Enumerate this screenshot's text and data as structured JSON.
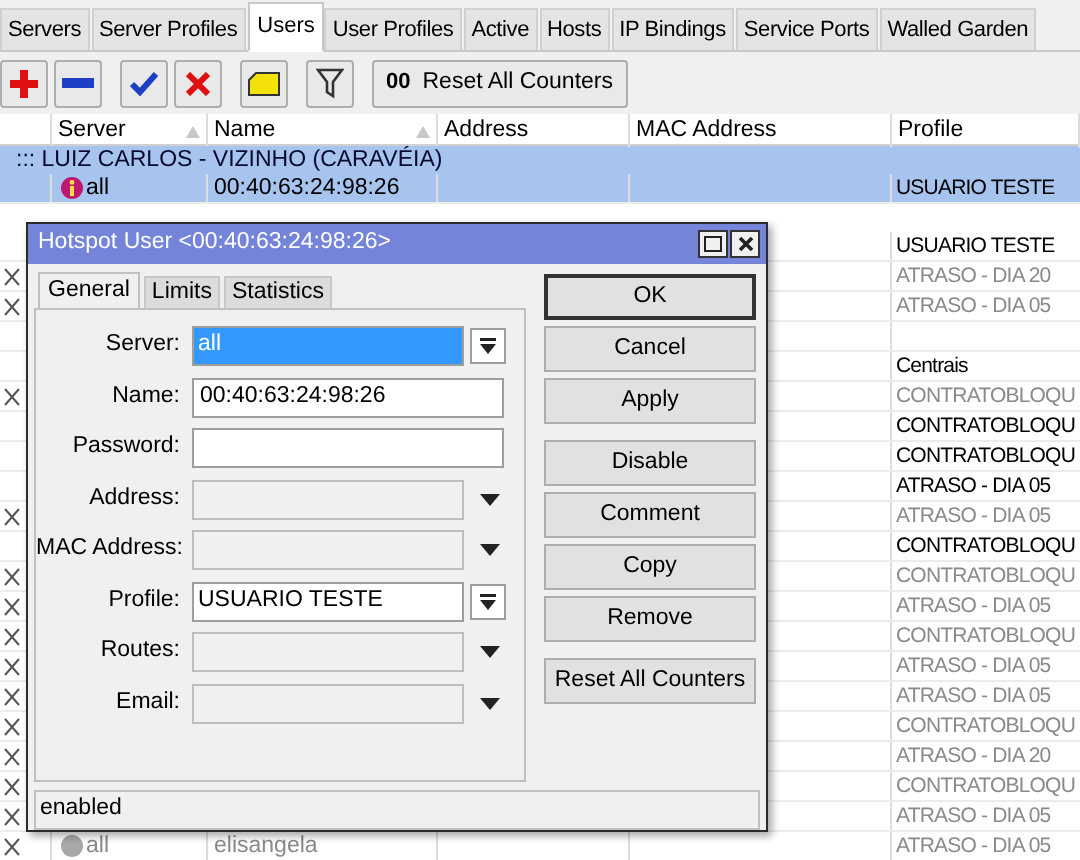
{
  "tabs": [
    {
      "label": "Servers",
      "selected": false
    },
    {
      "label": "Server Profiles",
      "selected": false
    },
    {
      "label": "Users",
      "selected": true
    },
    {
      "label": "User Profiles",
      "selected": false
    },
    {
      "label": "Active",
      "selected": false
    },
    {
      "label": "Hosts",
      "selected": false
    },
    {
      "label": "IP Bindings",
      "selected": false
    },
    {
      "label": "Service Ports",
      "selected": false
    },
    {
      "label": "Walled Garden",
      "selected": false
    }
  ],
  "toolbar": {
    "groups": [
      [
        {
          "kind": "add"
        },
        {
          "kind": "remove"
        }
      ],
      [
        {
          "kind": "enable"
        },
        {
          "kind": "disable"
        }
      ],
      [
        {
          "kind": "comment"
        }
      ],
      [
        {
          "kind": "filter"
        }
      ]
    ],
    "reset_button": {
      "badge": "00",
      "label": "Reset All Counters"
    }
  },
  "table": {
    "columns": [
      {
        "label": "Server",
        "sorted": true
      },
      {
        "label": "Name",
        "sorted": true
      },
      {
        "label": "Address",
        "sorted": false
      },
      {
        "label": "MAC Address",
        "sorted": false
      },
      {
        "label": "Profile",
        "sorted": false
      }
    ],
    "rows": [
      {
        "kind": "comment",
        "text": "::: LUIZ CARLOS - VIZINHO (CARAVÉIA)",
        "selected": true
      },
      {
        "kind": "user",
        "selected": true,
        "disabled": false,
        "server": "all",
        "name": "00:40:63:24:98:26",
        "profile": "USUARIO TESTE"
      },
      {
        "kind": "covered"
      },
      {
        "kind": "user",
        "selected": false,
        "disabled": false,
        "profile": "USUARIO TESTE"
      },
      {
        "kind": "user",
        "selected": false,
        "disabled": true,
        "profile": "ATRASO - DIA 20"
      },
      {
        "kind": "user",
        "selected": false,
        "disabled": true,
        "profile": "ATRASO - DIA 05"
      },
      {
        "kind": "user",
        "selected": false,
        "disabled": false
      },
      {
        "kind": "user",
        "selected": false,
        "disabled": false,
        "profile": "Centrais"
      },
      {
        "kind": "user",
        "selected": false,
        "disabled": true,
        "profile": "CONTRATOBLOQU"
      },
      {
        "kind": "user",
        "selected": false,
        "disabled": false,
        "profile": "CONTRATOBLOQU"
      },
      {
        "kind": "user",
        "selected": false,
        "disabled": false,
        "profile": "CONTRATOBLOQU"
      },
      {
        "kind": "user",
        "selected": false,
        "disabled": false,
        "profile": "ATRASO - DIA 05"
      },
      {
        "kind": "user",
        "selected": false,
        "disabled": true,
        "profile": "ATRASO - DIA 05"
      },
      {
        "kind": "user",
        "selected": false,
        "disabled": false,
        "profile": "CONTRATOBLOQU"
      },
      {
        "kind": "user",
        "selected": false,
        "disabled": true,
        "profile": "CONTRATOBLOQU"
      },
      {
        "kind": "user",
        "selected": false,
        "disabled": true,
        "profile": "ATRASO - DIA 05"
      },
      {
        "kind": "user",
        "selected": false,
        "disabled": true,
        "profile": "CONTRATOBLOQU"
      },
      {
        "kind": "user",
        "selected": false,
        "disabled": true,
        "profile": "ATRASO - DIA 05"
      },
      {
        "kind": "user",
        "selected": false,
        "disabled": true,
        "profile": "ATRASO - DIA 05"
      },
      {
        "kind": "user",
        "selected": false,
        "disabled": true,
        "profile": "CONTRATOBLOQU"
      },
      {
        "kind": "user",
        "selected": false,
        "disabled": true,
        "profile": "ATRASO - DIA 20"
      },
      {
        "kind": "user",
        "selected": false,
        "disabled": true,
        "profile": "CONTRATOBLOQU"
      },
      {
        "kind": "user",
        "selected": false,
        "disabled": true,
        "profile": "ATRASO - DIA 05"
      },
      {
        "kind": "user",
        "selected": false,
        "disabled": true,
        "server": "all",
        "name": "elisangela",
        "profile": "ATRASO - DIA 05"
      }
    ]
  },
  "dialog": {
    "title": "Hotspot User <00:40:63:24:98:26>",
    "tabs": [
      {
        "label": "General",
        "selected": true
      },
      {
        "label": "Limits",
        "selected": false
      },
      {
        "label": "Statistics",
        "selected": false
      }
    ],
    "fields": [
      {
        "label": "Server:",
        "kind": "select",
        "value": "all",
        "highlighted": true
      },
      {
        "label": "Name:",
        "kind": "text",
        "value": "00:40:63:24:98:26",
        "highlighted": false
      },
      {
        "label": "Password:",
        "kind": "text",
        "highlighted": false
      },
      {
        "label": "Address:",
        "kind": "combo",
        "highlighted": false
      },
      {
        "label": "MAC Address:",
        "kind": "combo",
        "highlighted": false
      },
      {
        "label": "Profile:",
        "kind": "select",
        "value": "USUARIO TESTE",
        "highlighted": false
      },
      {
        "label": "Routes:",
        "kind": "combo",
        "highlighted": false
      },
      {
        "label": "Email:",
        "kind": "combo",
        "highlighted": false
      }
    ],
    "button_groups": [
      [
        {
          "label": "OK",
          "default": true
        },
        {
          "label": "Cancel",
          "default": false
        },
        {
          "label": "Apply",
          "default": false
        }
      ],
      [
        {
          "label": "Disable",
          "default": false
        },
        {
          "label": "Comment",
          "default": false
        },
        {
          "label": "Copy",
          "default": false
        },
        {
          "label": "Remove",
          "default": false
        }
      ],
      [
        {
          "label": "Reset All Counters",
          "default": false
        }
      ]
    ],
    "status": "enabled"
  }
}
